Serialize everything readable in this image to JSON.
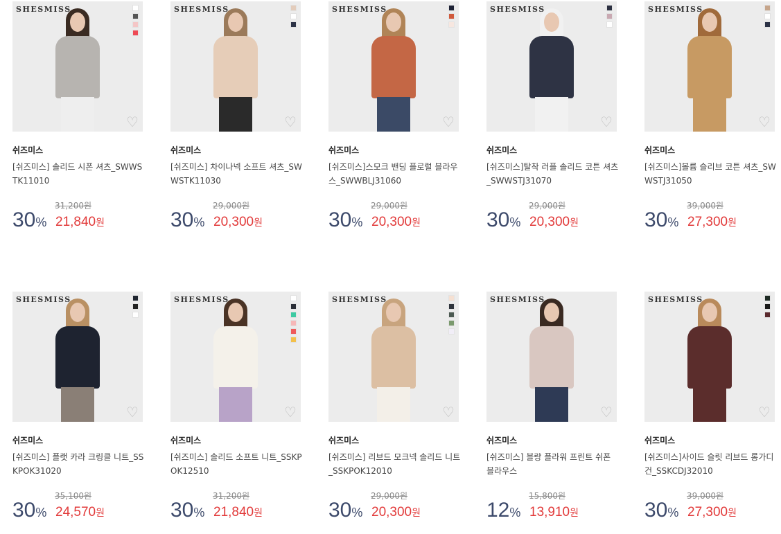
{
  "products": [
    {
      "logo": "SHESMISS",
      "brand": "쉬즈미스",
      "name": "[쉬즈미스] 솔리드 시폰 셔츠_SWWSTK11010",
      "original_price": "31,200원",
      "discount": "30",
      "discount_unit": "%",
      "price": "21,840",
      "price_unit": "원",
      "swatches": [
        "#ffffff",
        "#555555",
        "#f4c6c6",
        "#ee4a55"
      ],
      "top_color": "#b7b4b0",
      "bottom_color": "#eeeeee",
      "hair_color": "#3a2b22"
    },
    {
      "logo": "SHESMISS",
      "brand": "쉬즈미스",
      "name": "[쉬즈미스] 차이나넥 소프트 셔츠_SWWSTK11030",
      "original_price": "29,000원",
      "discount": "30",
      "discount_unit": "%",
      "price": "20,300",
      "price_unit": "원",
      "swatches": [
        "#e3ccbb",
        "#ffffff",
        "#2c3346"
      ],
      "top_color": "#e6cdb8",
      "bottom_color": "#2a2a2a",
      "hair_color": "#9b7a5a"
    },
    {
      "logo": "SHESMISS",
      "brand": "쉬즈미스",
      "name": "[쉬즈미스]스모크 밴딩 플로럴 블라우스_SWWBLJ31060",
      "original_price": "29,000원",
      "discount": "30",
      "discount_unit": "%",
      "price": "20,300",
      "price_unit": "원",
      "swatches": [
        "#1d2235",
        "#d05a3c",
        "#f7e7e0"
      ],
      "top_color": "#c46745",
      "bottom_color": "#3b4a66",
      "hair_color": "#b08457"
    },
    {
      "logo": "SHESMISS",
      "brand": "쉬즈미스",
      "name": "[쉬즈미스]탈착 러플 솔리드 코튼 셔츠_SWWSTJ31070",
      "original_price": "29,000원",
      "discount": "30",
      "discount_unit": "%",
      "price": "20,300",
      "price_unit": "원",
      "swatches": [
        "#2d3142",
        "#c9a9b2",
        "#ffffff"
      ],
      "top_color": "#2e3344",
      "bottom_color": "#f1f1f1",
      "hair_color": "#f1f1f1"
    },
    {
      "logo": "SHESMISS",
      "brand": "쉬즈미스",
      "name": "[쉬즈미스]볼륨 슬리브 코튼 셔츠_SWWSTJ31050",
      "original_price": "39,000원",
      "discount": "30",
      "discount_unit": "%",
      "price": "27,300",
      "price_unit": "원",
      "swatches": [
        "#c6a58b",
        "#ffffff",
        "#2b3246"
      ],
      "top_color": "#c79a63",
      "bottom_color": "#c79a63",
      "hair_color": "#a06a3b"
    },
    {
      "logo": "SHESMISS",
      "brand": "쉬즈미스",
      "name": "[쉬즈미스] 플랫 카라 크링클 니트_SSKPOK31020",
      "original_price": "35,100원",
      "discount": "30",
      "discount_unit": "%",
      "price": "24,570",
      "price_unit": "원",
      "swatches": [
        "#1f2530",
        "#222222",
        "#ffffff"
      ],
      "top_color": "#1e2330",
      "bottom_color": "#8a7f76",
      "hair_color": "#b99063"
    },
    {
      "logo": "SHESMISS",
      "brand": "쉬즈미스",
      "name": "[쉬즈미스] 솔리드 소프트 니트_SSKPOK12510",
      "original_price": "31,200원",
      "discount": "30",
      "discount_unit": "%",
      "price": "21,840",
      "price_unit": "원",
      "swatches": [
        "#ffffff",
        "#2a2d36",
        "#3ccaa2",
        "#f6b8b8",
        "#ef5a5a",
        "#f3c04a"
      ],
      "top_color": "#f4f1ea",
      "bottom_color": "#b8a3c8",
      "hair_color": "#4a3325"
    },
    {
      "logo": "SHESMISS",
      "brand": "쉬즈미스",
      "name": "[쉬즈미스] 리브드 모크넥 솔리드 니트_SSKPOK12010",
      "original_price": "29,000원",
      "discount": "30",
      "discount_unit": "%",
      "price": "20,300",
      "price_unit": "원",
      "swatches": [
        "#f5e0d2",
        "#2f343c",
        "#4c5a52",
        "#7b9a6e",
        "#f1eef7"
      ],
      "top_color": "#dcbfa3",
      "bottom_color": "#f3efe8",
      "hair_color": "#c8a47e"
    },
    {
      "logo": "SHESMISS",
      "brand": "쉬즈미스",
      "name": "[쉬즈미스] 블랑 플라워 프린트 쉬폰 블라우스",
      "original_price": "15,800원",
      "discount": "12",
      "discount_unit": "%",
      "price": "13,910",
      "price_unit": "원",
      "swatches": [],
      "top_color": "#d9c7c1",
      "bottom_color": "#2e3a55",
      "hair_color": "#3a2a22"
    },
    {
      "logo": "SHESMISS",
      "brand": "쉬즈미스",
      "name": "[쉬즈미스]사이드 슬릿 리브드 롱가디건_SSKCDJ32010",
      "original_price": "39,000원",
      "discount": "30",
      "discount_unit": "%",
      "price": "27,300",
      "price_unit": "원",
      "swatches": [
        "#1e2b24",
        "#1a1a1a",
        "#5a2a2e"
      ],
      "top_color": "#5b2d2c",
      "bottom_color": "#5b2d2c",
      "hair_color": "#b98a5b"
    }
  ],
  "heart_glyph": "♡"
}
